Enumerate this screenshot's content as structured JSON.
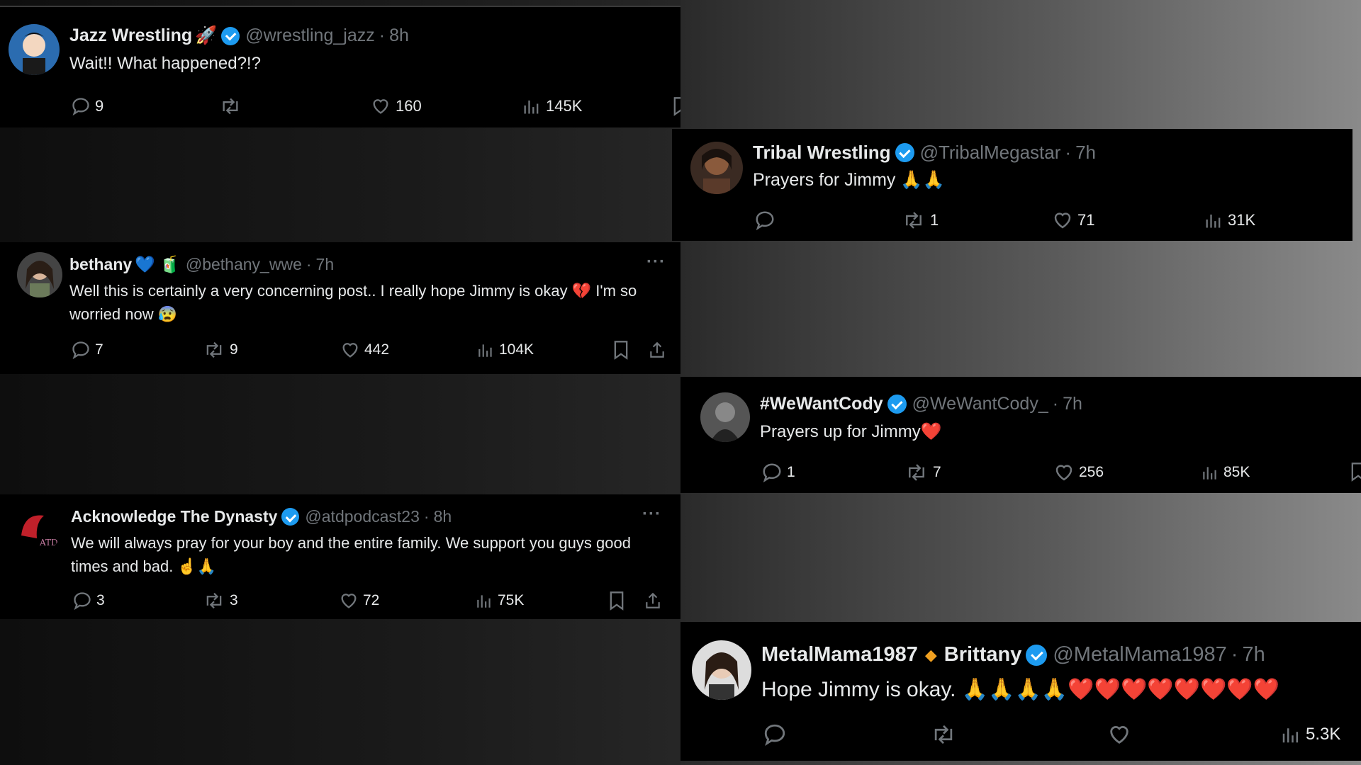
{
  "tweets": [
    {
      "name": "Jazz Wrestling",
      "name_emoji": "🚀",
      "handle": "@wrestling_jazz",
      "time": "8h",
      "text": "Wait!! What happened?!?",
      "replies": "9",
      "reposts": "",
      "likes": "160",
      "views": "145K"
    },
    {
      "name": "Tribal Wrestling",
      "handle": "@TribalMegastar",
      "time": "7h",
      "text": "Prayers for Jimmy 🙏🙏",
      "replies": "",
      "reposts": "1",
      "likes": "71",
      "views": "31K"
    },
    {
      "name": "bethany",
      "name_emoji": "💙 🧃",
      "handle": "@bethany_wwe",
      "time": "7h",
      "text": "Well this is certainly a very concerning post.. I really hope Jimmy is okay 💔 I'm so worried now 😰",
      "replies": "7",
      "reposts": "9",
      "likes": "442",
      "views": "104K",
      "more": "···"
    },
    {
      "name": "#WeWantCody",
      "handle": "@WeWantCody_",
      "time": "7h",
      "text": "Prayers up for Jimmy❤️",
      "replies": "1",
      "reposts": "7",
      "likes": "256",
      "views": "85K"
    },
    {
      "name": "Acknowledge The Dynasty",
      "handle": "@atdpodcast23",
      "time": "8h",
      "text": "We will always pray for your boy and the entire family. We support you guys good times and bad. ☝️🙏",
      "replies": "3",
      "reposts": "3",
      "likes": "72",
      "views": "75K",
      "more": "···"
    },
    {
      "name": "MetalMama1987",
      "name_sep": "◆",
      "name2": "Brittany",
      "handle": "@MetalMama1987",
      "time": "7h",
      "text": "Hope Jimmy is okay. 🙏🙏🙏🙏❤️❤️❤️❤️❤️❤️❤️❤️",
      "replies": "",
      "reposts": "",
      "likes": "",
      "views": "5.3K"
    }
  ],
  "separator": "·",
  "icons": [
    "reply-icon",
    "repost-icon",
    "like-icon",
    "views-icon",
    "bookmark-icon",
    "share-icon",
    "verified-badge-icon"
  ],
  "colors": {
    "verified": "#1d9bf0",
    "text": "#e7e9ea",
    "muted": "#71767b",
    "card": "#000000"
  }
}
